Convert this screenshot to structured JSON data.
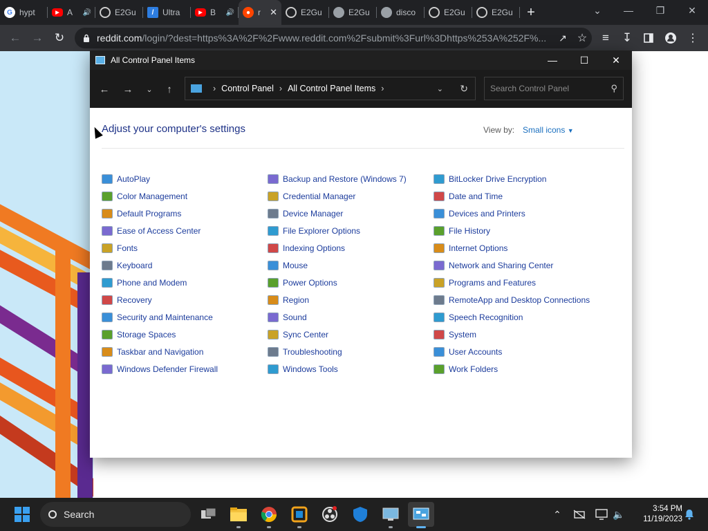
{
  "browser": {
    "tabs": [
      {
        "title": "hypt",
        "favicon": "google-icon",
        "color": "#ffffff",
        "audio": false
      },
      {
        "title": "A",
        "favicon": "youtube-icon",
        "color": "#ff0000",
        "audio": true
      },
      {
        "title": "E2Gu",
        "favicon": "github-icon",
        "color": "#cccccc",
        "audio": false
      },
      {
        "title": "Ultra",
        "favicon": "ultra-icon",
        "color": "#2d7de0",
        "audio": false
      },
      {
        "title": "B",
        "favicon": "youtube-icon",
        "color": "#ff0000",
        "audio": true
      },
      {
        "title": "r",
        "favicon": "reddit-icon",
        "color": "#ff4500",
        "audio": false,
        "active": true
      },
      {
        "title": "E2Gu",
        "favicon": "github-icon",
        "color": "#cccccc",
        "audio": false
      },
      {
        "title": "E2Gu",
        "favicon": "globe-icon",
        "color": "#cccccc",
        "audio": false
      },
      {
        "title": "disco",
        "favicon": "globe-icon",
        "color": "#cccccc",
        "audio": false
      },
      {
        "title": "E2Gu",
        "favicon": "github-icon",
        "color": "#cccccc",
        "audio": false
      },
      {
        "title": "E2Gu",
        "favicon": "github-icon",
        "color": "#cccccc",
        "audio": false
      }
    ],
    "url_domain": "reddit.com",
    "url_rest": "/login/?dest=https%3A%2F%2Fwww.reddit.com%2Fsubmit%3Furl%3Dhttps%253A%252F%..."
  },
  "cp": {
    "title": "All Control Panel Items",
    "crumbs": [
      "Control Panel",
      "All Control Panel Items"
    ],
    "search_placeholder": "Search Control Panel",
    "heading": "Adjust your computer's settings",
    "view_by_label": "View by:",
    "view_by_value": "Small icons",
    "columns": [
      [
        "AutoPlay",
        "Color Management",
        "Default Programs",
        "Ease of Access Center",
        "Fonts",
        "Keyboard",
        "Phone and Modem",
        "Recovery",
        "Security and Maintenance",
        "Storage Spaces",
        "Taskbar and Navigation",
        "Windows Defender Firewall"
      ],
      [
        "Backup and Restore (Windows 7)",
        "Credential Manager",
        "Device Manager",
        "File Explorer Options",
        "Indexing Options",
        "Mouse",
        "Power Options",
        "Region",
        "Sound",
        "Sync Center",
        "Troubleshooting",
        "Windows Tools"
      ],
      [
        "BitLocker Drive Encryption",
        "Date and Time",
        "Devices and Printers",
        "File History",
        "Internet Options",
        "Network and Sharing Center",
        "Programs and Features",
        "RemoteApp and Desktop Connections",
        "Speech Recognition",
        "System",
        "User Accounts",
        "Work Folders"
      ]
    ],
    "icon_colors": [
      "#3a8fd8",
      "#5aa02c",
      "#d88c1a",
      "#7a6ad0",
      "#c9a227",
      "#6d7b8d",
      "#2f9bd0",
      "#d04848"
    ]
  },
  "taskbar": {
    "search_label": "Search",
    "time": "3:54 PM",
    "date": "11/19/2023"
  },
  "colors": {
    "chrome_dark": "#202124",
    "chrome_toolbar": "#35363a",
    "cp_link": "#1c3c9c",
    "cp_heading": "#1e3287",
    "view_by_value": "#1a6fbf"
  }
}
